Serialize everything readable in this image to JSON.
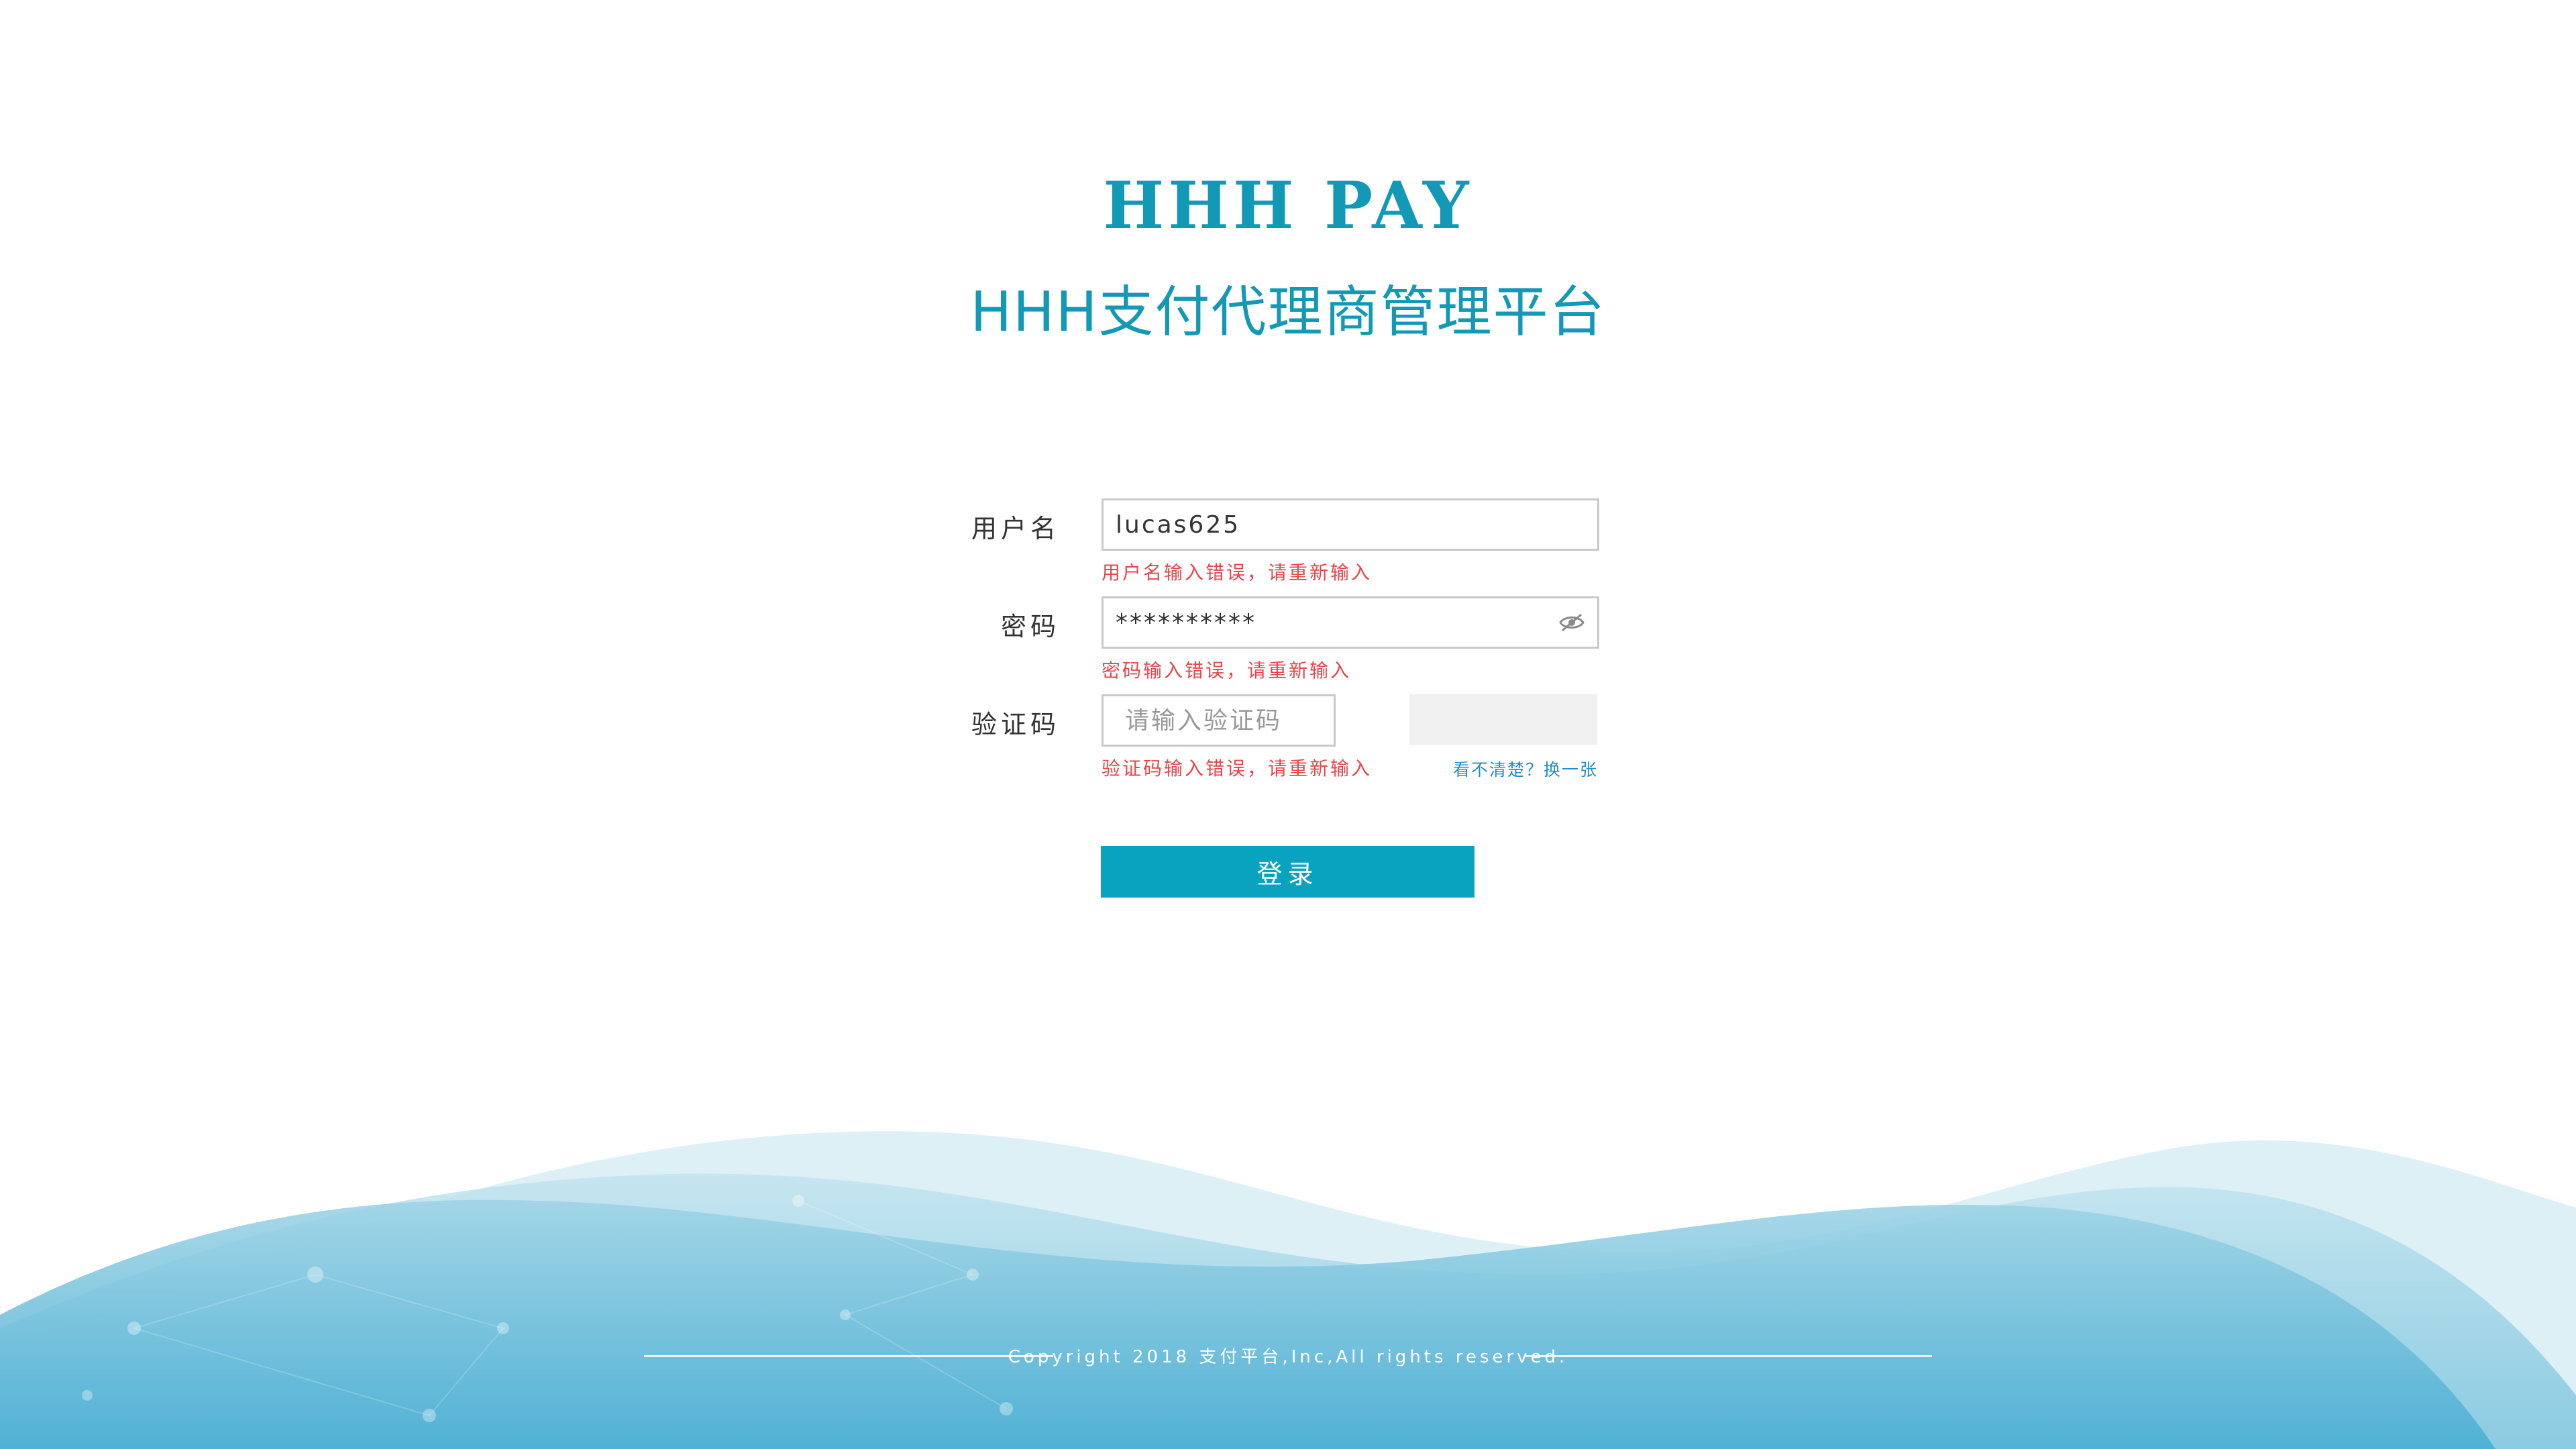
{
  "header": {
    "logo_text": "HHH PAY",
    "subtitle": "HHH支付代理商管理平台"
  },
  "form": {
    "username": {
      "label": "用户名",
      "value": "lucas625",
      "error": "用户名输入错误，请重新输入"
    },
    "password": {
      "label": "密码",
      "value": "**********",
      "error": "密码输入错误，请重新输入",
      "toggle_icon": "eye-off-icon"
    },
    "captcha": {
      "label": "验证码",
      "placeholder": "请输入验证码",
      "value": "",
      "error": "验证码输入错误，请重新输入",
      "refresh_link": "看不清楚？换一张"
    },
    "submit_label": "登录"
  },
  "footer": {
    "copyright": "Copyright 2018 支付平台,Inc,All rights reserved."
  },
  "colors": {
    "brand": "#1199b5",
    "button": "#0aa3bf",
    "error": "#e8454b",
    "link": "#1b8fcf",
    "wave_dark": "#4fb0d2",
    "wave_light": "#d7eef5"
  }
}
